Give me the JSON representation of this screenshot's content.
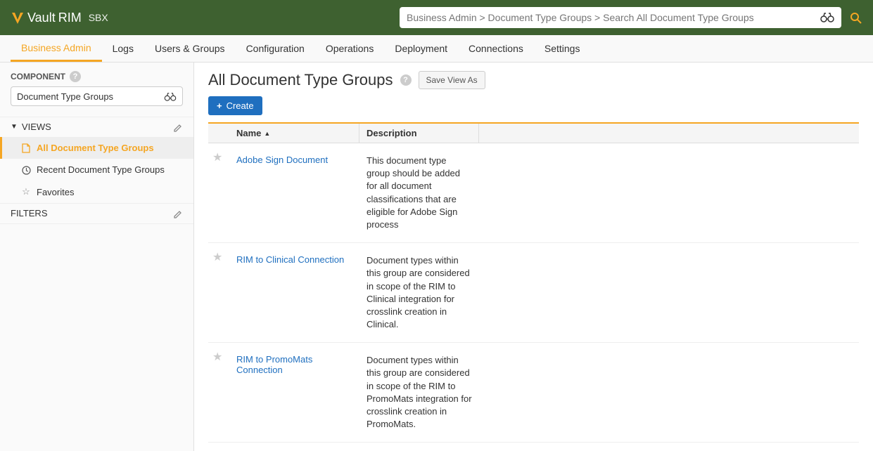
{
  "header": {
    "logo_vault": "Vault",
    "logo_rim": "RIM",
    "logo_sbx": "SBX",
    "search_placeholder": "Business Admin > Document Type Groups > Search All Document Type Groups"
  },
  "nav": {
    "items": [
      {
        "label": "Business Admin",
        "active": true
      },
      {
        "label": "Logs"
      },
      {
        "label": "Users & Groups"
      },
      {
        "label": "Configuration"
      },
      {
        "label": "Operations"
      },
      {
        "label": "Deployment"
      },
      {
        "label": "Connections"
      },
      {
        "label": "Settings"
      }
    ]
  },
  "sidebar": {
    "component_label": "COMPONENT",
    "component_value": "Document Type Groups",
    "views_label": "VIEWS",
    "views": [
      {
        "label": "All Document Type Groups",
        "icon": "document",
        "active": true
      },
      {
        "label": "Recent Document Type Groups",
        "icon": "clock"
      },
      {
        "label": "Favorites",
        "icon": "star"
      }
    ],
    "filters_label": "FILTERS"
  },
  "main": {
    "title": "All Document Type Groups",
    "save_view_label": "Save View As",
    "create_label": "Create",
    "columns": {
      "name": "Name",
      "description": "Description"
    },
    "rows": [
      {
        "name": "Adobe Sign Document",
        "description": "This document type group should be added for all document classifications that are eligible for Adobe Sign process"
      },
      {
        "name": "RIM to Clinical Connection",
        "description": "Document types within this group are considered in scope of the RIM to Clinical integration for crosslink creation in Clinical."
      },
      {
        "name": "RIM to PromoMats Connection",
        "description": "Document types within this group are considered in scope of the RIM to PromoMats integration for crosslink creation in PromoMats."
      }
    ]
  }
}
